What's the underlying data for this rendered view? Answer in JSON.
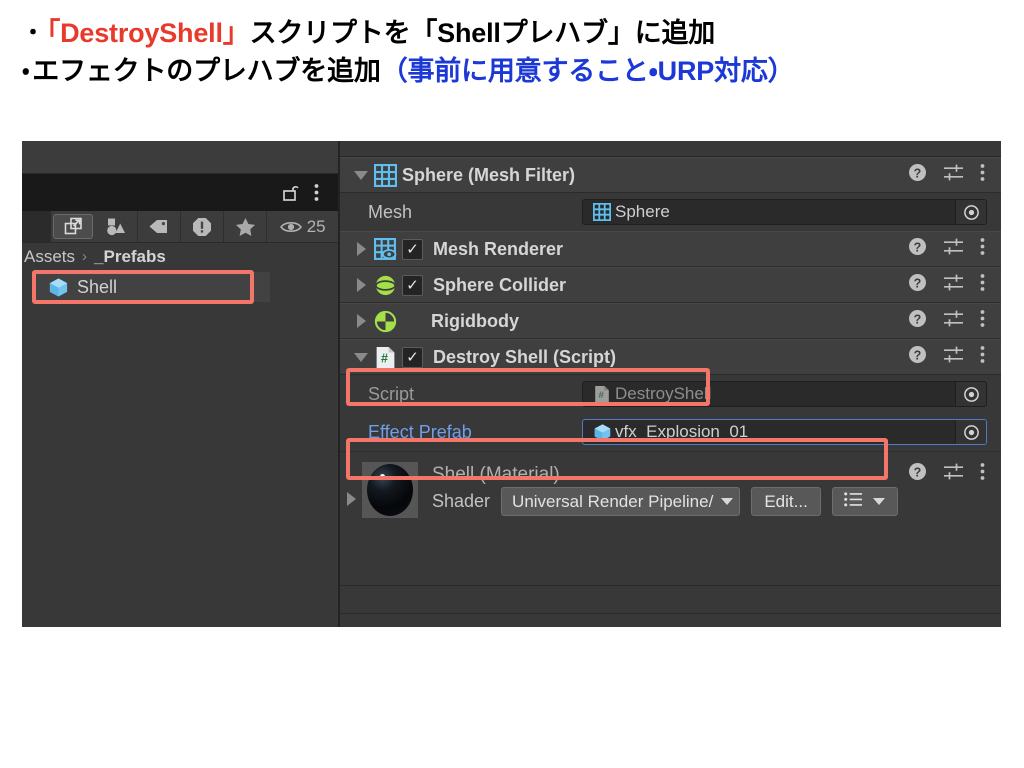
{
  "header": {
    "line1": {
      "bullet": "・",
      "part1_red": "「DestroyShell」",
      "part2": "スクリプトを「Shellプレハブ」に追加"
    },
    "line2": {
      "bullet": "・",
      "part1": "エフェクトのプレハブを追加",
      "part2_blue": "（事前に用意すること・URP対応）"
    }
  },
  "project_panel": {
    "lock_icon": "unlock-icon",
    "menu_icon": "kebab-menu-icon",
    "toolbar": [
      {
        "name": "expand-window-icon",
        "label": ""
      },
      {
        "name": "shapes-filter-icon",
        "label": ""
      },
      {
        "name": "tag-icon",
        "label": ""
      },
      {
        "name": "warning-icon",
        "label": ""
      },
      {
        "name": "favorites-star-icon",
        "label": ""
      },
      {
        "name": "visibility-eye-icon",
        "label": "25"
      }
    ],
    "breadcrumb": {
      "root": "Assets",
      "separator": "›",
      "current": "_Prefabs"
    },
    "assets": [
      {
        "name": "Shell",
        "icon": "prefab-cube-icon",
        "selected": true
      }
    ]
  },
  "inspector": {
    "components": [
      {
        "id": "mesh-filter",
        "title": "Sphere (Mesh Filter)",
        "icon": "mesh-filter-icon",
        "expanded": true,
        "has_checkbox": false,
        "highlighted": false
      },
      {
        "id": "mesh-renderer",
        "title": "Mesh Renderer",
        "icon": "mesh-renderer-icon",
        "expanded": false,
        "has_checkbox": true,
        "checked": true,
        "highlighted": false
      },
      {
        "id": "sphere-collider",
        "title": "Sphere Collider",
        "icon": "sphere-collider-icon",
        "expanded": false,
        "has_checkbox": true,
        "checked": true,
        "highlighted": false
      },
      {
        "id": "rigidbody",
        "title": "Rigidbody",
        "icon": "rigidbody-icon",
        "expanded": false,
        "has_checkbox": false,
        "highlighted": false
      },
      {
        "id": "destroy-shell-script",
        "title": "Destroy Shell (Script)",
        "icon": "csharp-script-icon",
        "expanded": true,
        "has_checkbox": true,
        "checked": true,
        "highlighted": true
      }
    ],
    "mesh_property": {
      "label": "Mesh",
      "value": "Sphere",
      "value_icon": "mesh-filter-icon",
      "picker_icon": "object-picker-icon"
    },
    "script_property": {
      "label": "Script",
      "value": "DestroyShell",
      "value_icon": "csharp-script-icon",
      "picker_icon": "object-picker-icon"
    },
    "effect_prefab_property": {
      "label": "Effect Prefab",
      "value": "vfx_Explosion_01",
      "value_icon": "prefab-cube-icon",
      "picker_icon": "object-picker-icon",
      "highlighted": true,
      "focused": true
    },
    "material": {
      "title": "Shell (Material)",
      "shader_label": "Shader",
      "shader_value": "Universal Render Pipeline/",
      "edit_button": "Edit...",
      "preset_icon": "preset-list-icon"
    },
    "action_icons": {
      "help": "help-icon",
      "settings": "settings-sliders-icon",
      "menu": "kebab-menu-icon"
    }
  },
  "colors": {
    "highlight_border": "#f4766a",
    "accent_blue": "#6e9fe8",
    "panel_bg": "#383838",
    "header_red": "#e8392a",
    "header_blue": "#1c39d8"
  }
}
